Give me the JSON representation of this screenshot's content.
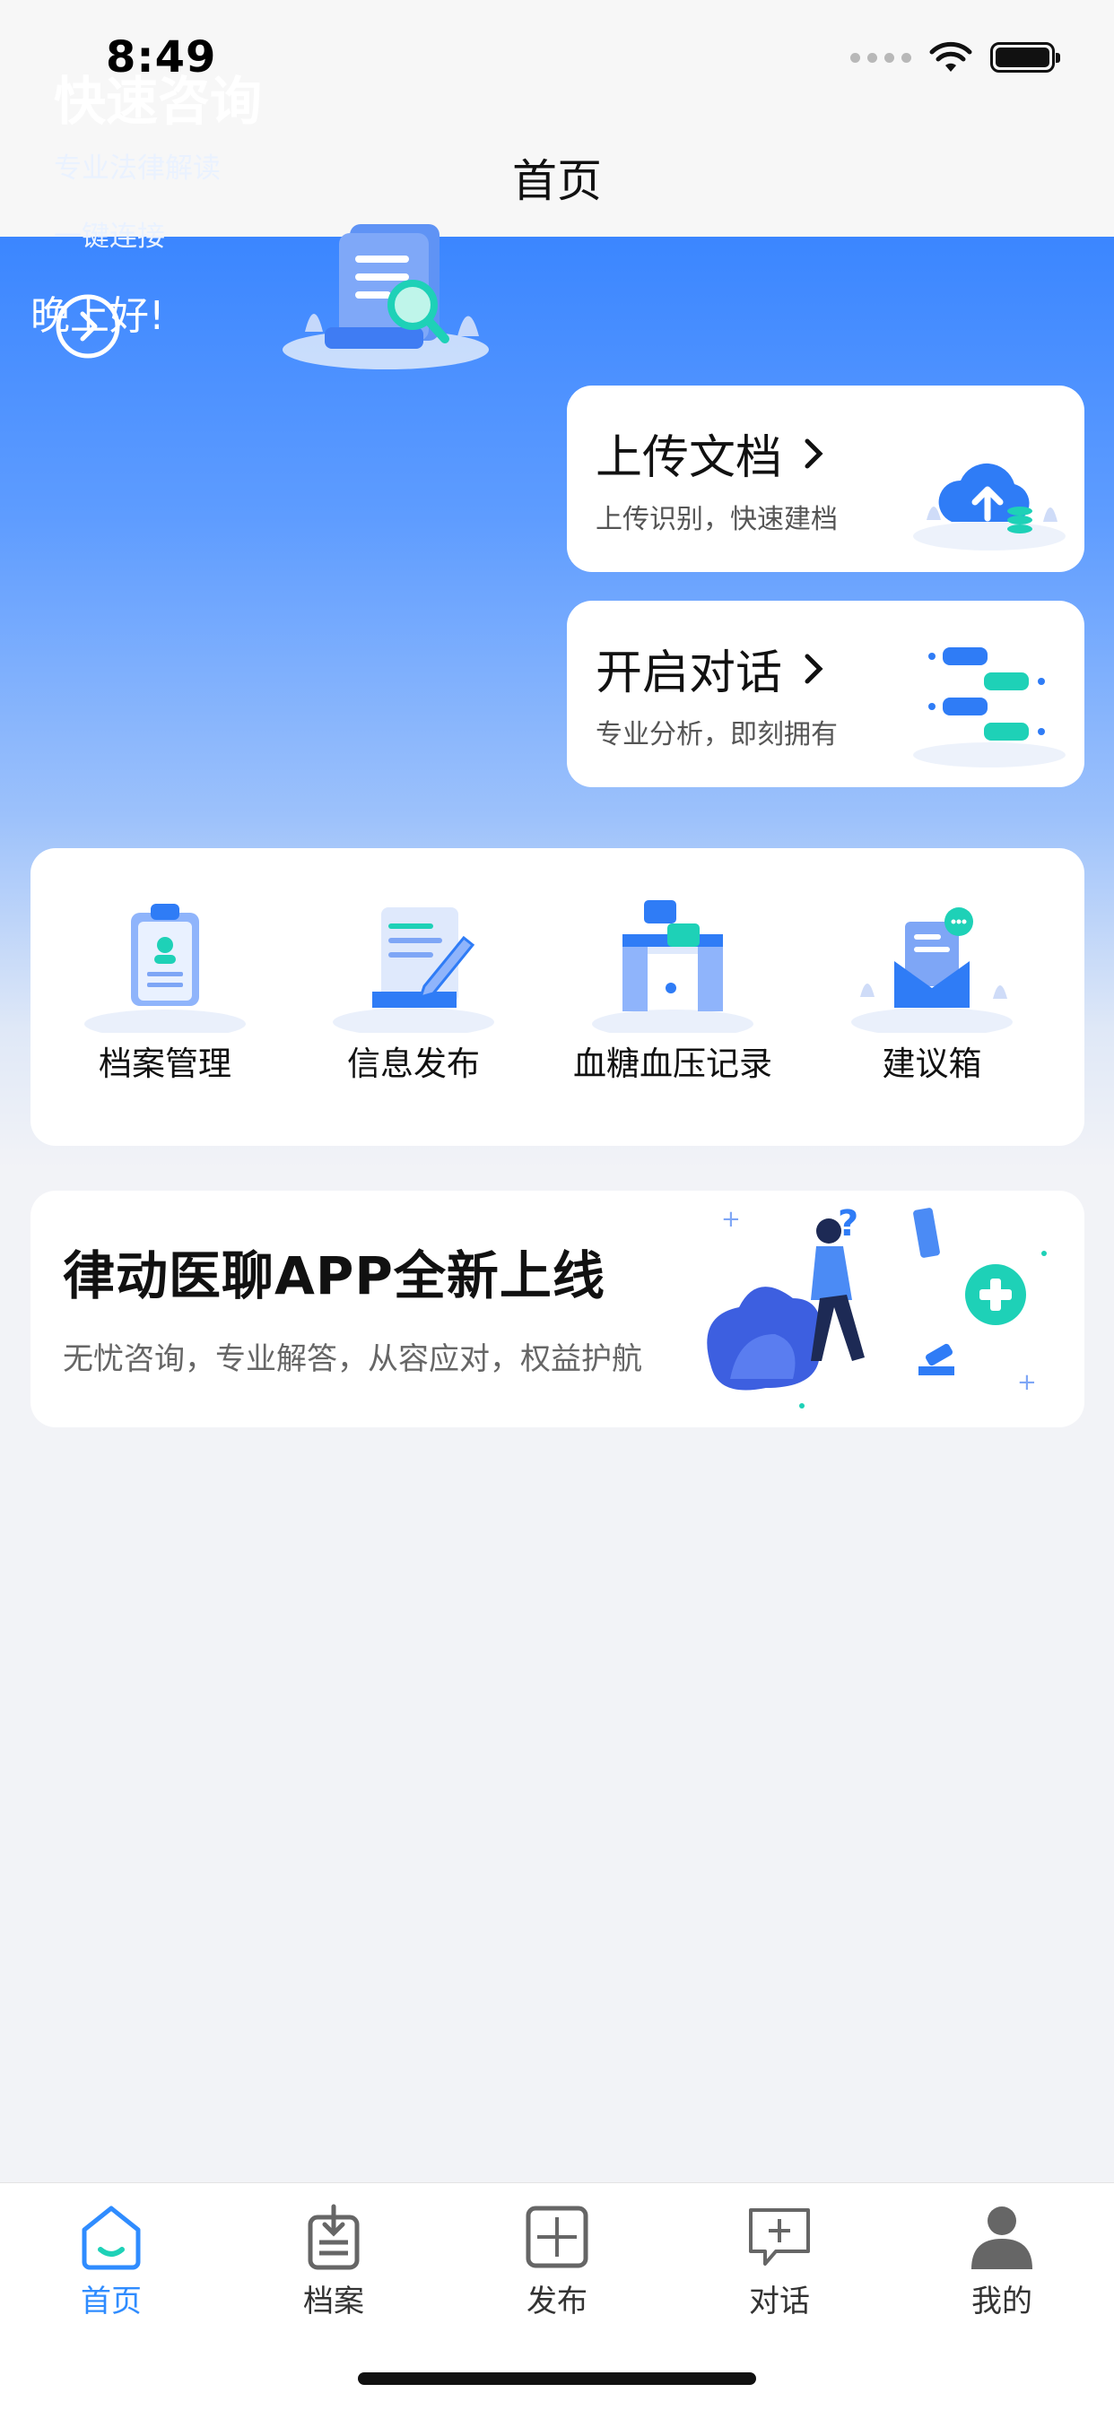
{
  "status_bar": {
    "time": "8:49"
  },
  "nav": {
    "title": "首页"
  },
  "greeting": "晚上好!",
  "quick_consult": {
    "title": "快速咨询",
    "subtitle_1": "专业法律解读",
    "subtitle_2": "一键连接"
  },
  "upload_doc": {
    "title": "上传文档",
    "subtitle": "上传识别，快速建档"
  },
  "start_chat": {
    "title": "开启对话",
    "subtitle": "专业分析，即刻拥有"
  },
  "grid_items": [
    {
      "label": "档案管理",
      "icon": "clipboard-profile-icon"
    },
    {
      "label": "信息发布",
      "icon": "document-pen-icon"
    },
    {
      "label": "血糖血压记录",
      "icon": "chat-gate-icon"
    },
    {
      "label": "建议箱",
      "icon": "mail-envelope-icon"
    }
  ],
  "promo": {
    "title": "律动医聊APP全新上线",
    "subtitle": "无忧咨询，专业解答，从容应对，权益护航"
  },
  "tabs": [
    {
      "label": "首页",
      "icon": "home-icon",
      "active": true
    },
    {
      "label": "档案",
      "icon": "archive-icon",
      "active": false
    },
    {
      "label": "发布",
      "icon": "plus-square-icon",
      "active": false
    },
    {
      "label": "对话",
      "icon": "chat-bubble-icon",
      "active": false
    },
    {
      "label": "我的",
      "icon": "user-icon",
      "active": false
    }
  ],
  "colors": {
    "accent": "#2f8cff",
    "hero_blue": "#3b86ff",
    "teal": "#1ed1b7"
  }
}
